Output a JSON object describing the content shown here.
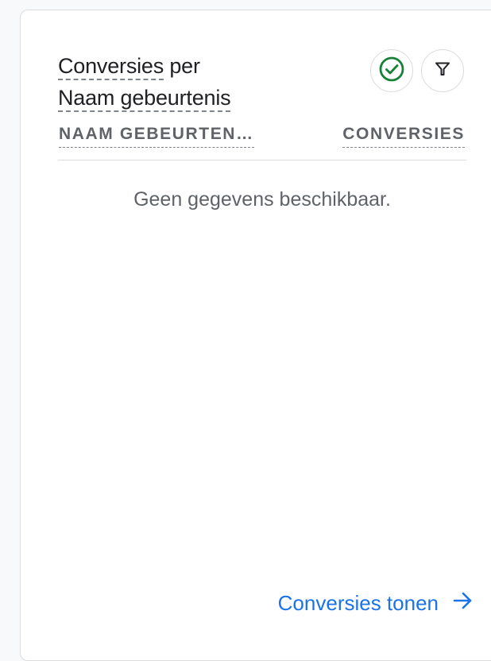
{
  "card": {
    "title_part1": "Conversies",
    "title_part2": " per",
    "title_part3": "Naam gebeurtenis",
    "check_icon": "check-circle-icon",
    "filter_icon": "filter-icon",
    "columns": {
      "name": "NAAM GEBEURTEN…",
      "value": "CONVERSIES"
    },
    "empty_message": "Geen gegevens beschikbaar.",
    "footer_link": "Conversies tonen",
    "footer_icon": "arrow-right-icon"
  },
  "colors": {
    "accent": "#1a73e8",
    "check_green": "#188038"
  }
}
